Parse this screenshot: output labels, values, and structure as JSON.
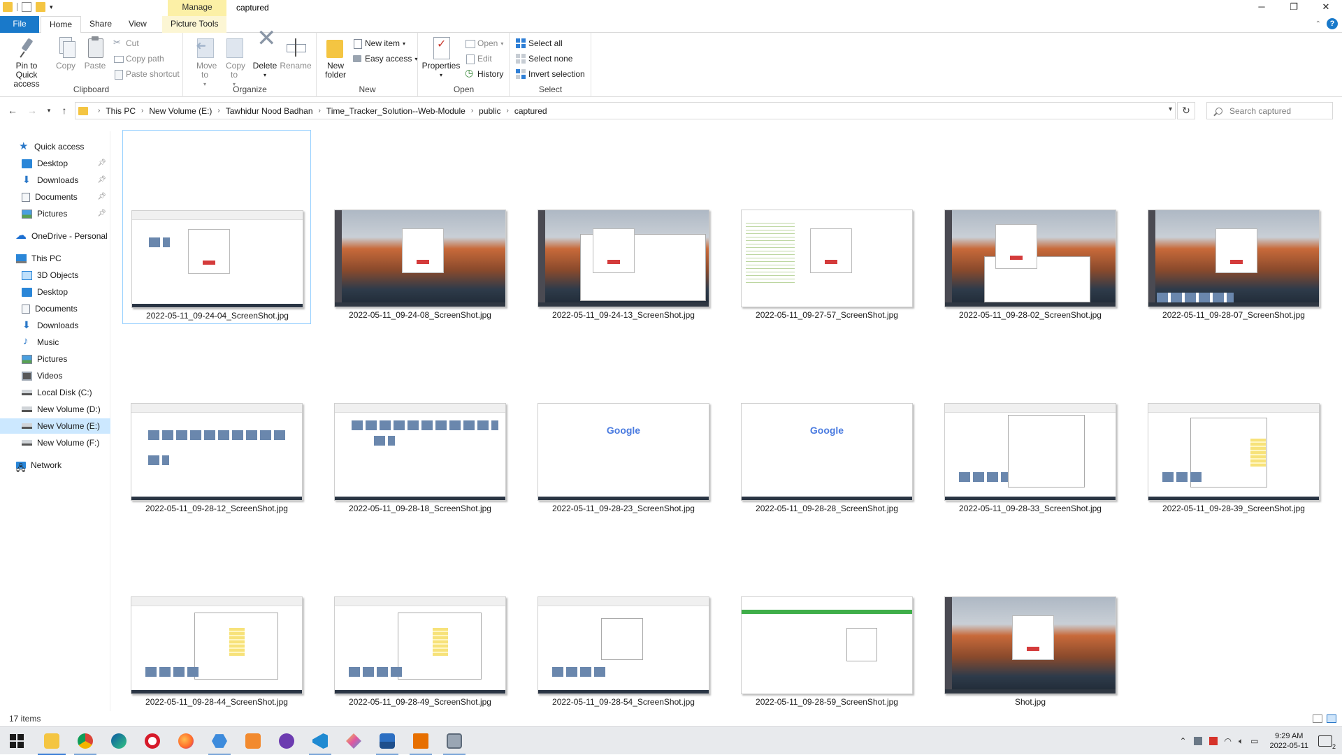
{
  "window": {
    "title": "captured",
    "context_tab": "Manage",
    "controls": {
      "minimize": "─",
      "maximize": "❐",
      "close": "✕"
    }
  },
  "ribbon_tabs": {
    "file": "File",
    "home": "Home",
    "share": "Share",
    "view": "View",
    "picture_tools": "Picture Tools"
  },
  "ribbon": {
    "clipboard": {
      "label": "Clipboard",
      "pin": "Pin to Quick access",
      "copy": "Copy",
      "paste": "Paste",
      "cut": "Cut",
      "copy_path": "Copy path",
      "paste_shortcut": "Paste shortcut"
    },
    "organize": {
      "label": "Organize",
      "move_to": "Move to",
      "copy_to": "Copy to",
      "delete": "Delete",
      "rename": "Rename"
    },
    "new": {
      "label": "New",
      "new_folder": "New folder",
      "new_item": "New item",
      "easy_access": "Easy access"
    },
    "open": {
      "label": "Open",
      "properties": "Properties",
      "open": "Open",
      "edit": "Edit",
      "history": "History"
    },
    "select": {
      "label": "Select",
      "select_all": "Select all",
      "select_none": "Select none",
      "invert_selection": "Invert selection"
    }
  },
  "address": {
    "crumbs": [
      "This PC",
      "New Volume (E:)",
      "Tawhidur Nood Badhan",
      "Time_Tracker_Solution--Web-Module",
      "public",
      "captured"
    ],
    "search_placeholder": "Search captured"
  },
  "nav": {
    "quick_access": "Quick access",
    "qa_items": [
      "Desktop",
      "Downloads",
      "Documents",
      "Pictures"
    ],
    "onedrive": "OneDrive - Personal",
    "this_pc": "This PC",
    "pc_items": [
      "3D Objects",
      "Desktop",
      "Documents",
      "Downloads",
      "Music",
      "Pictures",
      "Videos",
      "Local Disk (C:)",
      "New Volume (D:)",
      "New Volume (E:)",
      "New Volume (F:)"
    ],
    "network": "Network"
  },
  "files": [
    "2022-05-11_09-24-04_ScreenShot.jpg",
    "2022-05-11_09-24-08_ScreenShot.jpg",
    "2022-05-11_09-24-13_ScreenShot.jpg",
    "2022-05-11_09-27-57_ScreenShot.jpg",
    "2022-05-11_09-28-02_ScreenShot.jpg",
    "2022-05-11_09-28-07_ScreenShot.jpg",
    "2022-05-11_09-28-12_ScreenShot.jpg",
    "2022-05-11_09-28-18_ScreenShot.jpg",
    "2022-05-11_09-28-23_ScreenShot.jpg",
    "2022-05-11_09-28-28_ScreenShot.jpg",
    "2022-05-11_09-28-33_ScreenShot.jpg",
    "2022-05-11_09-28-39_ScreenShot.jpg",
    "2022-05-11_09-28-44_ScreenShot.jpg",
    "2022-05-11_09-28-49_ScreenShot.jpg",
    "2022-05-11_09-28-54_ScreenShot.jpg",
    "2022-05-11_09-28-59_ScreenShot.jpg",
    "Shot.jpg"
  ],
  "status": {
    "item_count": "17 items"
  },
  "taskbar": {
    "time": "9:29 AM",
    "date": "2022-05-11",
    "notification_count": "2",
    "apps": [
      "file-explorer",
      "chrome",
      "edge",
      "opera",
      "firefox",
      "app-hexagon",
      "app-orange",
      "app-purple",
      "vscode",
      "app-kite",
      "photos",
      "java",
      "app-window"
    ]
  },
  "colors": {
    "accent": "#1979ca",
    "manage_tab": "#fcf0a6",
    "selection": "#cce8ff",
    "folder": "#f4c542"
  }
}
